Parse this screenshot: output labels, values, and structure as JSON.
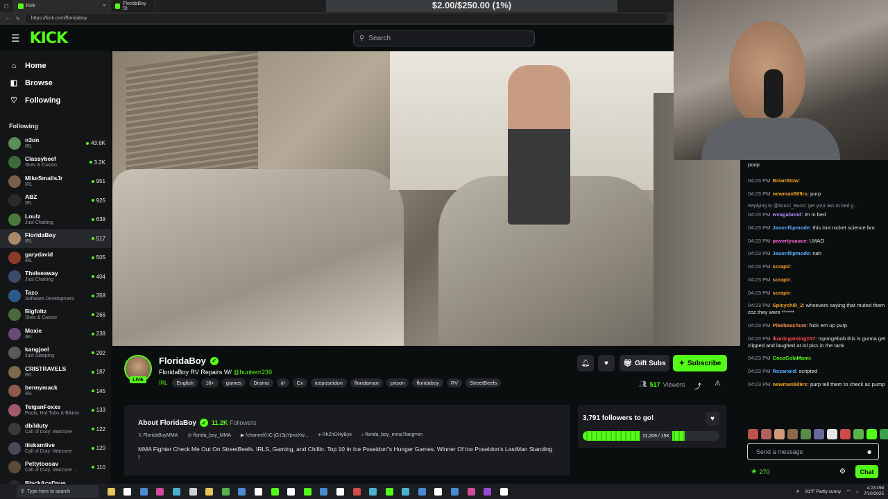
{
  "browser": {
    "tabs": [
      {
        "label": "Kick",
        "close": "×"
      },
      {
        "label": "FloridaBoy St"
      }
    ],
    "url": "https://kick.com/floridaboy"
  },
  "overlay": {
    "donation_goal": "$2.00/$250.00 (1%)"
  },
  "header": {
    "logo": "KICK",
    "search_placeholder": "Search"
  },
  "nav": [
    {
      "label": "Home",
      "icon": "home-icon"
    },
    {
      "label": "Browse",
      "icon": "compass-icon"
    },
    {
      "label": "Following",
      "icon": "heart-icon"
    }
  ],
  "following": {
    "heading": "Following",
    "channels": [
      {
        "name": "n3on",
        "category": "IRL",
        "viewers": "43.6K",
        "color": "#5a8f5a"
      },
      {
        "name": "Classybeef",
        "category": "Slots & Casino",
        "viewers": "3.2K",
        "color": "#3a6b3a"
      },
      {
        "name": "MikeSmallsJr",
        "category": "IRL",
        "viewers": "951",
        "color": "#7a5f4a"
      },
      {
        "name": "ABZ",
        "category": "IRL",
        "viewers": "925",
        "color": "#2b2b2b"
      },
      {
        "name": "Loulz",
        "category": "Just Chatting",
        "viewers": "639",
        "color": "#4a7a3a"
      },
      {
        "name": "FloridaBoy",
        "category": "IRL",
        "viewers": "517",
        "color": "#a88a6a"
      },
      {
        "name": "garydavid",
        "category": "IRL",
        "viewers": "505",
        "color": "#8a3a2a"
      },
      {
        "name": "Theleeaway",
        "category": "Just Chatting",
        "viewers": "404",
        "color": "#3a4a6a"
      },
      {
        "name": "Tazo",
        "category": "Software Development",
        "viewers": "358",
        "color": "#2a5a8a"
      },
      {
        "name": "Bigfoltz",
        "category": "Slots & Casino",
        "viewers": "266",
        "color": "#4a6a3a"
      },
      {
        "name": "Moxie",
        "category": "IRL",
        "viewers": "238",
        "color": "#6a4a7a"
      },
      {
        "name": "kangjoel",
        "category": "Just Sleeping",
        "viewers": "202",
        "color": "#5a5a5a"
      },
      {
        "name": "CRISTRAVELS",
        "category": "IRL",
        "viewers": "187",
        "color": "#7a6a4a"
      },
      {
        "name": "bennymack",
        "category": "IRL",
        "viewers": "145",
        "color": "#8a5a4a"
      },
      {
        "name": "TeiganFoxxe",
        "category": "Pools, Hot Tubs & Bikinis",
        "viewers": "133",
        "color": "#a05a6a"
      },
      {
        "name": "dbilduty",
        "category": "Call of Duty: Warzone",
        "viewers": "122",
        "color": "#3a3a3a"
      },
      {
        "name": "liiskamlive",
        "category": "Call of Duty: Warzone",
        "viewers": "120",
        "color": "#4a4a5a"
      },
      {
        "name": "Pettytoosav",
        "category": "Call of Duty: Warzone ...",
        "viewers": "110",
        "color": "#5a4a3a"
      },
      {
        "name": "BlackAceDave",
        "category": "IRL",
        "viewers": "107",
        "color": "#2a2a2a"
      }
    ]
  },
  "stream": {
    "streamer": "FloridaBoy",
    "live_badge": "LIVE",
    "title": "FloridaBoy RV Repairs W/",
    "mention": "@hunterrr239",
    "category": "IRL",
    "tags": [
      "English",
      "18+",
      "games",
      "Drama",
      "irl",
      "Cx",
      "iceposeidon",
      "floridaman",
      "prison",
      "floridaboy",
      "RV",
      "StreetBeefs"
    ],
    "viewers_count": "517",
    "viewers_label": "Viewers",
    "gift_subs": "Gift Subs",
    "subscribe": "Subscribe"
  },
  "about": {
    "title": "About FloridaBoy",
    "followers": "11.2K",
    "followers_label": "Followers",
    "socials": [
      "FloridaBoyMMA",
      "florida_boy_MMA",
      "/channel/UC-jG13pYpnzXw...",
      "RhZnDHyByx",
      "florida_boy_mma?lang=en"
    ],
    "bio": "MMA Fighter Check Me Out On StreetBeefs. IRLS, Gaming, and Chillin. Top 10 In Ice Poseidon\"s Hunger Games. Winner Of Ice Poseidon's LastMan Standing !"
  },
  "goal": {
    "title": "3,791 followers to go!",
    "progress_label": "11,209 / 15K",
    "progress": 0.747
  },
  "chat": {
    "messages": [
      {
        "time": "",
        "user": "",
        "text": "poop",
        "color": "#ffffff"
      },
      {
        "time": "04:23 PM",
        "user": "BrianStow",
        "text": ":",
        "color": "#f5a623"
      },
      {
        "time": "04:23 PM",
        "user": "newman509rs",
        "text": ": purp",
        "color": "#f5a623"
      },
      {
        "reply": "Replying to @Gucci_Bucci: get your ass to bed g...",
        "time": "04:23 PM",
        "user": "wvagabond",
        "text": ": im in bed",
        "color": "#b38cff"
      },
      {
        "time": "04:23 PM",
        "user": "Jasonflipmode",
        "text": ": this isnt rocket science bro",
        "color": "#5ab0ff"
      },
      {
        "time": "04:23 PM",
        "user": "povertysauce",
        "text": ": LMAO",
        "color": "#ff6ad5"
      },
      {
        "time": "04:23 PM",
        "user": "Jasonflipmode",
        "text": ": nah",
        "color": "#5ab0ff"
      },
      {
        "time": "04:23 PM",
        "user": "scrapir",
        "text": ":",
        "color": "#f5a623"
      },
      {
        "time": "04:23 PM",
        "user": "scrapir",
        "text": ":",
        "color": "#f5a623"
      },
      {
        "time": "04:23 PM",
        "user": "scrapir",
        "text": ":",
        "color": "#f5a623"
      },
      {
        "time": "04:23 PM",
        "user": "Spicychili_2",
        "text": ": whoevers saying that muted them coz they were ******",
        "color": "#f5a623"
      },
      {
        "time": "04:23 PM",
        "user": "Pikebeechum",
        "text": ": fuck em up purp",
        "color": "#ff8a4a"
      },
      {
        "time": "04:23 PM",
        "user": "ikonicgaming157",
        "text": ": !spongebob this is gunna get clipped and laughed at lol piss in the tank",
        "color": "#ff4a4a"
      },
      {
        "time": "04:23 PM",
        "user": "CocaColaMami",
        "text": ":",
        "color": "#53fc18"
      },
      {
        "time": "04:23 PM",
        "user": "Rezanoid",
        "text": ": scripted",
        "color": "#5ab0ff"
      },
      {
        "time": "04:23 PM",
        "user": "newman509rs",
        "text": ": purp tell them to check ac pump",
        "color": "#f5a623"
      }
    ],
    "input_placeholder": "Send a message",
    "points": "270",
    "send": "Chat"
  },
  "taskbar": {
    "search": "Type here to search",
    "weather": "91°F  Partly sunny",
    "time": "4:23 PM",
    "date": "7/10/2025"
  }
}
